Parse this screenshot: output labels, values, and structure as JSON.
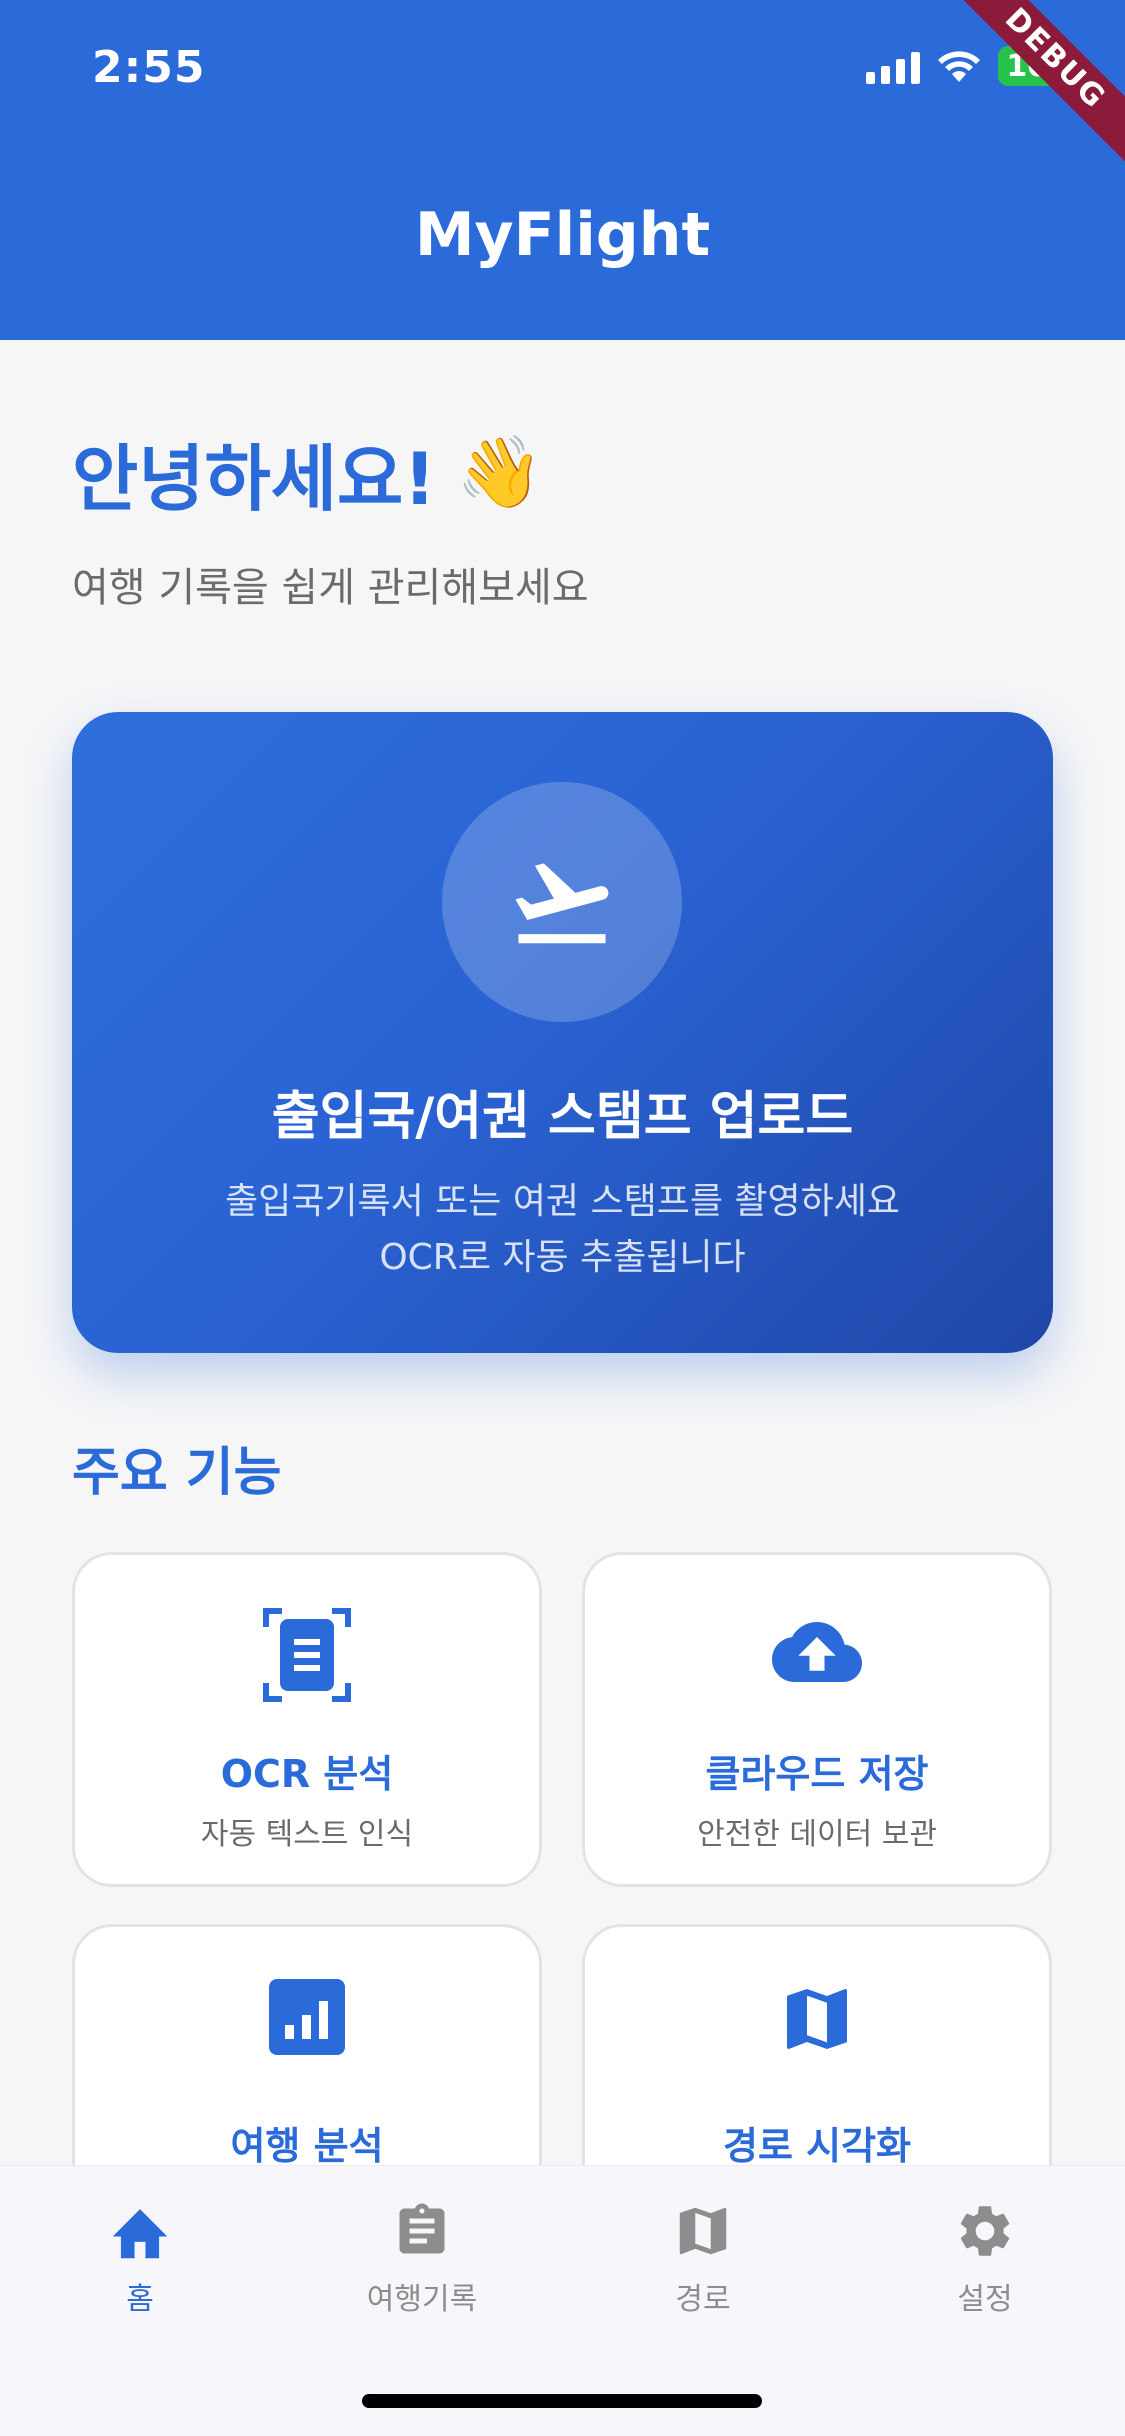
{
  "status_bar": {
    "time": "2:55",
    "battery": "100",
    "debug": "DEBUG"
  },
  "header": {
    "title": "MyFlight"
  },
  "greeting": {
    "title": "안녕하세요!",
    "emoji": "👋",
    "subtitle": "여행 기록을 쉽게 관리해보세요"
  },
  "upload": {
    "title": "출입국/여권 스탬프 업로드",
    "desc_line1": "출입국기록서 또는 여권 스탬프를 촬영하세요",
    "desc_line2": "OCR로 자동 추출됩니다",
    "icon": "flight-takeoff-icon"
  },
  "features": {
    "section_title": "주요 기능",
    "items": [
      {
        "title": "OCR 분석",
        "desc": "자동 텍스트 인식",
        "icon": "document-scanner-icon"
      },
      {
        "title": "클라우드 저장",
        "desc": "안전한 데이터 보관",
        "icon": "cloud-upload-icon"
      },
      {
        "title": "여행 분석",
        "desc": "",
        "icon": "bar-chart-icon"
      },
      {
        "title": "경로 시각화",
        "desc": "",
        "icon": "map-icon"
      }
    ]
  },
  "nav": {
    "items": [
      {
        "label": "홈",
        "icon": "home-icon",
        "active": true
      },
      {
        "label": "여행기록",
        "icon": "clipboard-icon",
        "active": false
      },
      {
        "label": "경로",
        "icon": "map-icon",
        "active": false
      },
      {
        "label": "설정",
        "icon": "gear-icon",
        "active": false
      }
    ]
  },
  "colors": {
    "primary": "#2a6ad9",
    "muted": "#8d8d8d",
    "background": "#f6f6f7"
  }
}
